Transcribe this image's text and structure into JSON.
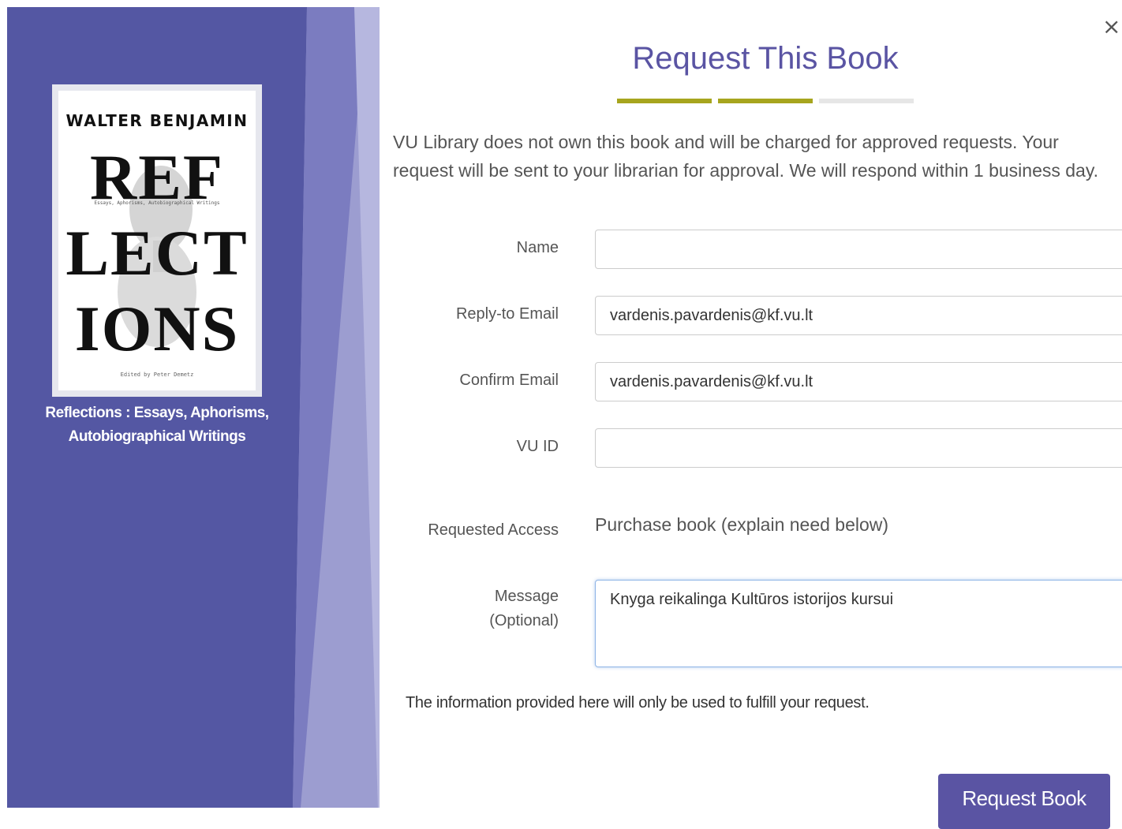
{
  "book": {
    "cover": {
      "author": "WALTER BENJAMIN",
      "title_lines": [
        "REF",
        "LECT",
        "IONS"
      ],
      "subtitle": "Essays, Aphorisms, Autobiographical Writings",
      "editor": "Edited by Peter Demetz"
    },
    "caption": "Reflections : Essays, Aphorisms, Autobiographical Writings"
  },
  "dialog": {
    "title": "Request This Book",
    "close_icon": "close-icon",
    "progress_steps": [
      {
        "state": "complete",
        "color": "#a7a51e"
      },
      {
        "state": "complete",
        "color": "#a7a51e"
      },
      {
        "state": "pending",
        "color": "#e6e6e6"
      }
    ],
    "intro": "VU Library does not own this book and will be charged for approved requests. Your request will be sent to your librarian for approval. We will respond within 1 business day."
  },
  "form": {
    "name": {
      "label": "Name",
      "value": ""
    },
    "reply_email": {
      "label": "Reply-to Email",
      "value": "vardenis.pavardenis@kf.vu.lt"
    },
    "confirm_email": {
      "label": "Confirm Email",
      "value": "vardenis.pavardenis@kf.vu.lt"
    },
    "vu_id": {
      "label": "VU ID",
      "value": ""
    },
    "requested_access": {
      "label": "Requested Access",
      "value": "Purchase book (explain need below)"
    },
    "message": {
      "label_line1": "Message",
      "label_line2": "(Optional)",
      "value": "Knyga reikalinga Kultūros istorijos kursui"
    },
    "privacy_note": "The information provided here will only be used to fulfill your request.",
    "submit_label": "Request Book"
  },
  "colors": {
    "panel": "#5457a3",
    "panel_accent": "#7b7cc0",
    "panel_light": "#9c9dd0",
    "accent": "#5a54a3",
    "progress": "#a7a51e"
  }
}
